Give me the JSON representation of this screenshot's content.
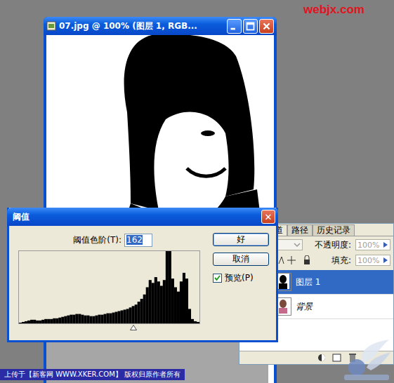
{
  "watermark": "webjx.com",
  "document": {
    "title": "07.jpg @ 100% (图层 1, RGB..."
  },
  "layers_panel": {
    "tabs": [
      {
        "label": "道",
        "selected": true
      },
      {
        "label": "路径",
        "selected": false
      },
      {
        "label": "历史记录",
        "selected": false
      }
    ],
    "opacity_label": "不透明度:",
    "opacity": "100%",
    "fill_label": "填充:",
    "fill": "100%",
    "layers": [
      {
        "name": "图层 1",
        "selected": true,
        "italic": false
      },
      {
        "name": "背景",
        "selected": false,
        "italic": true
      }
    ]
  },
  "dialog": {
    "title": "阈值",
    "close": "✕",
    "threshold_label": "阈值色阶(T):",
    "threshold_value": "162",
    "buttons": [
      {
        "label": "好",
        "default": true
      },
      {
        "label": "取消",
        "default": false
      }
    ],
    "preview": {
      "label": "预览(P)",
      "checked": true
    },
    "histogram": [
      1,
      2,
      3,
      4,
      5,
      5,
      4,
      4,
      5,
      6,
      6,
      6,
      7,
      7,
      8,
      9,
      10,
      11,
      12,
      12,
      13,
      13,
      12,
      11,
      11,
      10,
      10,
      11,
      12,
      12,
      13,
      14,
      14,
      15,
      16,
      17,
      18,
      19,
      20,
      22,
      24,
      26,
      30,
      34,
      40,
      50,
      60,
      56,
      64,
      58,
      52,
      60,
      100,
      100,
      62,
      50,
      44,
      58,
      70,
      62,
      20,
      6,
      3,
      2
    ],
    "slider_level": 0.635
  },
  "banner": "上传于【新客网 WWW.XKER.COM】 版权归原作者所有"
}
